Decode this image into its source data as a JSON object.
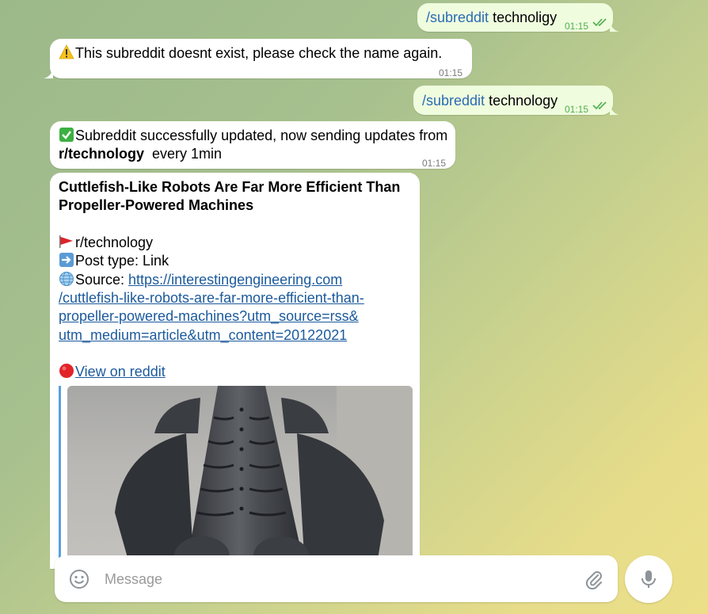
{
  "messages": {
    "m1": {
      "command": "/subreddit",
      "text": " technoligy",
      "time": "01:15"
    },
    "m2": {
      "text": "This subreddit doesnt exist, please check the name again.",
      "time": "01:15"
    },
    "m3": {
      "command": "/subreddit",
      "text": " technology",
      "time": "01:15"
    },
    "m4": {
      "line1": "Subreddit successfully updated, now sending updates from",
      "subreddit": "r/technology",
      "interval": "every 1min",
      "time": "01:15"
    },
    "m5": {
      "title": "Cuttlefish-Like Robots Are Far More Efficient Than Propeller-Powered Machines",
      "subreddit": "r/technology",
      "post_type": "Post type: Link",
      "source_label": "Source: ",
      "source_url_1": "https://interestingengineering.com",
      "source_url_2": "/cuttlefish-like-robots-are-far-more-efficient-than-",
      "source_url_3": "propeller-powered-machines?utm_source=rss&",
      "source_url_4": "utm_medium=article&utm_content=20122021",
      "reddit_link": "View on reddit"
    }
  },
  "composer": {
    "placeholder": "Message"
  },
  "icons": [
    "warning-icon",
    "check-icon",
    "flag-icon",
    "arrow-right-icon",
    "globe-icon",
    "red-circle-icon",
    "smile-icon",
    "attach-icon",
    "mic-icon",
    "read-ticks-icon"
  ],
  "colors": {
    "outgoing_bubble": "#effdde",
    "incoming_bubble": "#ffffff",
    "link": "#1c5a9c",
    "time_outgoing": "#4fae4e"
  }
}
